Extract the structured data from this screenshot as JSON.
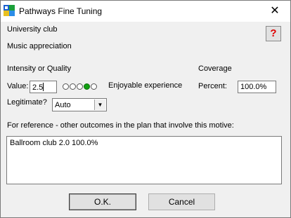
{
  "window": {
    "title": "Pathways Fine Tuning",
    "close_glyph": "✕"
  },
  "header": {
    "club": "University club",
    "motive": "Music appreciation",
    "help_glyph": "?"
  },
  "intensity": {
    "heading": "Intensity or Quality",
    "value_label": "Value:",
    "value": "2.5",
    "rating_level": 4,
    "rating_max": 5,
    "rating_color": "#12a012",
    "description": "Enjoyable experience"
  },
  "coverage": {
    "heading": "Coverage",
    "percent_label": "Percent:",
    "percent_value": "100.0%"
  },
  "legitimate": {
    "label": "Legitimate?",
    "selected": "Auto"
  },
  "reference": {
    "label": "For reference - other outcomes in the plan that involve this motive:",
    "items": [
      "Ballroom club 2.0 100.0%"
    ]
  },
  "buttons": {
    "ok": "O.K.",
    "cancel": "Cancel"
  },
  "icons": [
    "app-icon",
    "close-icon",
    "help-icon",
    "dropdown-arrow-icon"
  ]
}
